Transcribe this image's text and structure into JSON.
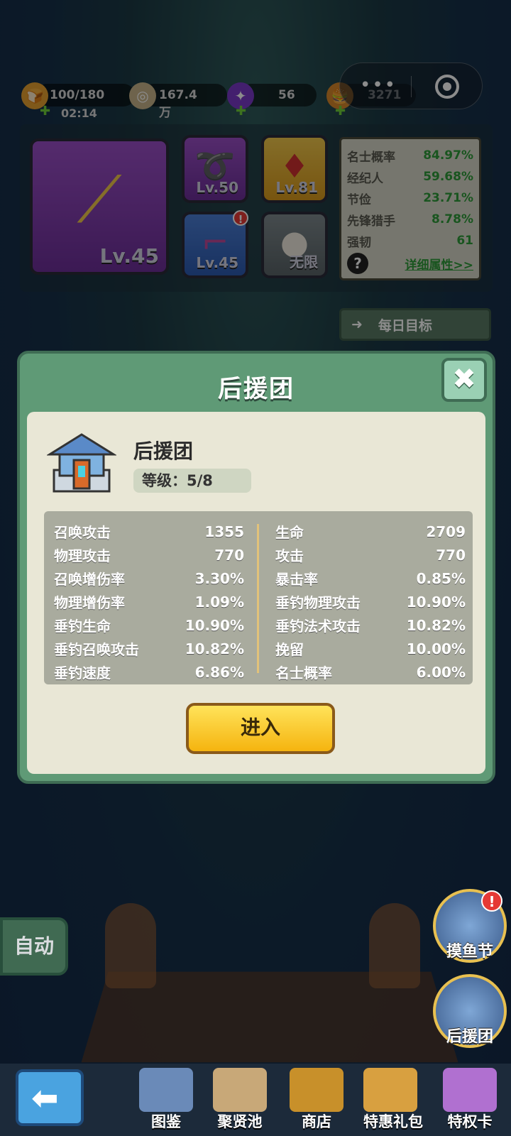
{
  "resources": {
    "stamina": {
      "value": "100/180",
      "timer": "02:14"
    },
    "coins": {
      "value": "167.4万"
    },
    "gems": {
      "value": "56"
    },
    "burger": {
      "value": "3271"
    }
  },
  "equipment": {
    "main_level": "Lv.45",
    "slots": [
      {
        "level": "Lv.50"
      },
      {
        "level": "Lv.81"
      },
      {
        "level": "Lv.45",
        "badge": "!"
      },
      {
        "level": "无限"
      }
    ]
  },
  "attributes_panel": {
    "rows": [
      {
        "label": "名士概率",
        "value": "84.97%"
      },
      {
        "label": "经纪人",
        "value": "59.68%"
      },
      {
        "label": "节俭",
        "value": "23.71%"
      },
      {
        "label": "先锋猎手",
        "value": "8.78%"
      },
      {
        "label": "强韧",
        "value": "61"
      }
    ],
    "help": "?",
    "detail_link": "详细属性>>"
  },
  "daily_goal": {
    "label": "每日目标"
  },
  "modal": {
    "title": "后援团",
    "close": "✖",
    "building": {
      "name": "后援团",
      "level": "等级：5/8"
    },
    "left_stats": [
      {
        "label": "召唤攻击",
        "value": "1355"
      },
      {
        "label": "物理攻击",
        "value": "770"
      },
      {
        "label": "召唤增伤率",
        "value": "3.30%"
      },
      {
        "label": "物理增伤率",
        "value": "1.09%"
      },
      {
        "label": "垂钓生命",
        "value": "10.90%"
      },
      {
        "label": "垂钓召唤攻击",
        "value": "10.82%"
      },
      {
        "label": "垂钓速度",
        "value": "6.86%"
      }
    ],
    "right_stats": [
      {
        "label": "生命",
        "value": "2709"
      },
      {
        "label": "攻击",
        "value": "770"
      },
      {
        "label": "暴击率",
        "value": "0.85%"
      },
      {
        "label": "垂钓物理攻击",
        "value": "10.90%"
      },
      {
        "label": "垂钓法术攻击",
        "value": "10.82%"
      },
      {
        "label": "挽留",
        "value": "10.00%"
      },
      {
        "label": "名士概率",
        "value": "6.00%"
      }
    ],
    "enter_label": "进入"
  },
  "scene": {
    "auto_label": "自动",
    "side_buttons": [
      {
        "label": "摸鱼节",
        "badge": "!"
      },
      {
        "label": "后援团"
      }
    ]
  },
  "bottom_nav": {
    "tabs": [
      {
        "label": "图鉴"
      },
      {
        "label": "聚贤池"
      },
      {
        "label": "商店"
      },
      {
        "label": "特惠礼包"
      },
      {
        "label": "特权卡"
      }
    ]
  }
}
